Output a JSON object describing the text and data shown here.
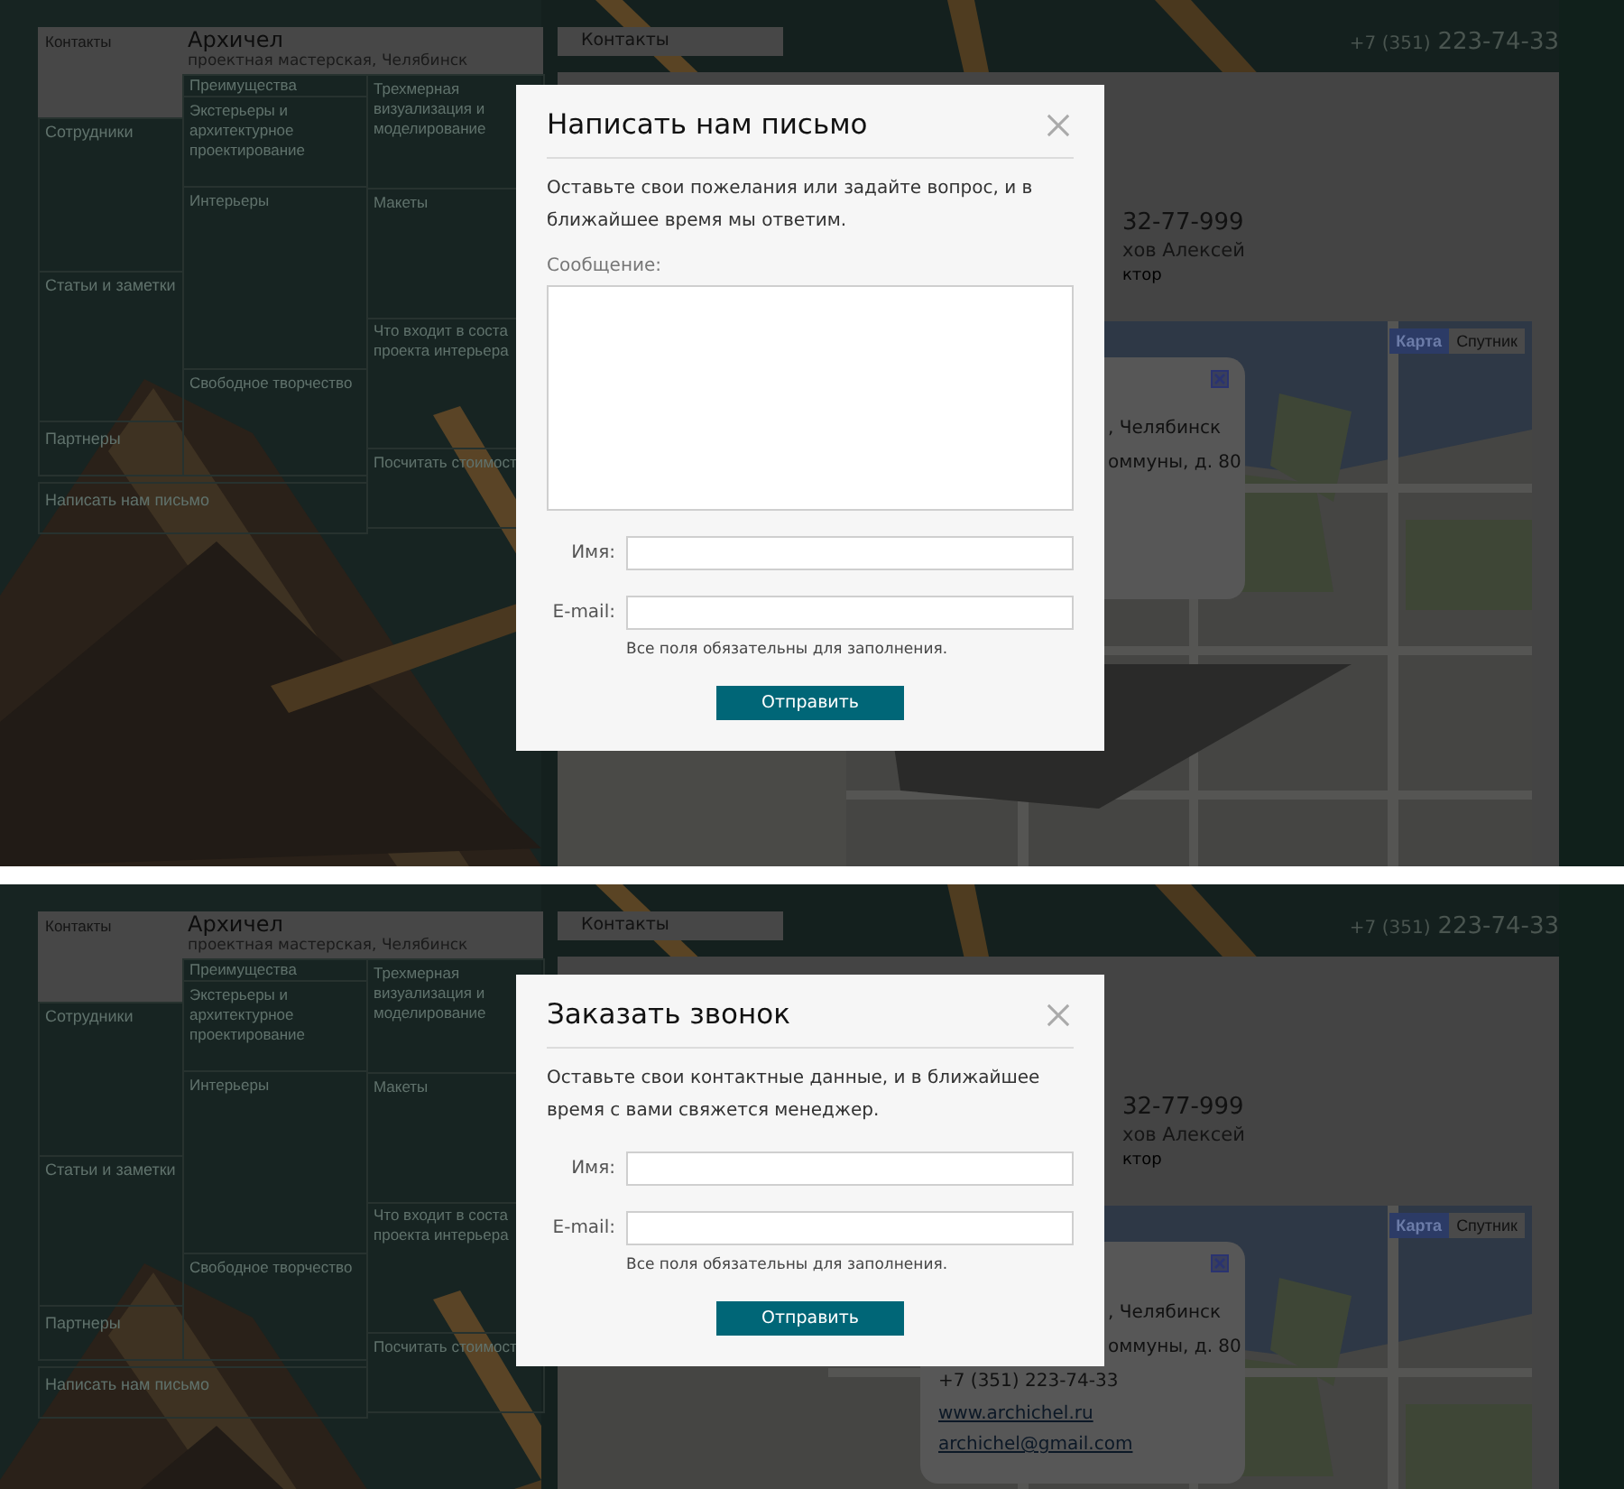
{
  "screens": [
    {
      "site": {
        "brand": {
          "name": "Архичел",
          "tagline": "проектная мастерская, Челябинск"
        },
        "menu_main": [
          {
            "label": "Контакты",
            "selected": true
          },
          {
            "label": "Сотрудники",
            "selected": false
          },
          {
            "label": "Статьи и заметки",
            "selected": false
          },
          {
            "label": "Партнеры",
            "selected": false
          }
        ],
        "menu_services": [
          {
            "label": "Преимущества",
            "selected": false
          },
          {
            "label": "Экстерьеры и архитектурное проектирование",
            "selected": false
          },
          {
            "label": "Интерьеры",
            "selected": false
          },
          {
            "label": "Свободное творчество",
            "selected": false
          }
        ],
        "menu_extra": [
          {
            "label": "Трехмерная визуализация и моделирование",
            "selected": false
          },
          {
            "label": "Макеты",
            "selected": false
          },
          {
            "label": "Что входит в соста\nпроекта интерьера",
            "selected": false
          },
          {
            "label": "Посчитать стоимост",
            "selected": false
          }
        ],
        "write_link": "Написать нам письмо",
        "tab": "Контакты",
        "phone": {
          "prefix": "+7 (351)",
          "number": "223-74-33"
        },
        "contact": {
          "phone": "32-77-999",
          "name": "хов Алексей",
          "role": "ктор"
        },
        "map": {
          "modes": [
            {
              "label": "Карта",
              "selected": true
            },
            {
              "label": "Спутник",
              "selected": false
            }
          ],
          "bubble": [
            {
              "kind": "tail",
              "text": ", Челябинск"
            },
            {
              "kind": "tail",
              "text": "оммуны, д. 80"
            }
          ]
        }
      },
      "dialog": {
        "title": "Написать нам письмо",
        "description": "Оставьте свои пожелания или задайте вопрос, и в ближайшее время мы ответим.",
        "fields": [
          {
            "kind": "textarea",
            "label": "Сообщение:"
          },
          {
            "kind": "input",
            "label": "Имя:"
          },
          {
            "kind": "input",
            "label": "E-mail:"
          }
        ],
        "note": "Все поля обязательны для заполнения.",
        "submit": "Отправить"
      }
    },
    {
      "site": {
        "brand": {
          "name": "Архичел",
          "tagline": "проектная мастерская, Челябинск"
        },
        "menu_main": [
          {
            "label": "Контакты",
            "selected": true
          },
          {
            "label": "Сотрудники",
            "selected": false
          },
          {
            "label": "Статьи и заметки",
            "selected": false
          },
          {
            "label": "Партнеры",
            "selected": false
          }
        ],
        "menu_services": [
          {
            "label": "Преимущества",
            "selected": false
          },
          {
            "label": "Экстерьеры и архитектурное проектирование",
            "selected": false
          },
          {
            "label": "Интерьеры",
            "selected": false
          },
          {
            "label": "Свободное творчество",
            "selected": false
          }
        ],
        "menu_extra": [
          {
            "label": "Трехмерная визуализация и моделирование",
            "selected": false
          },
          {
            "label": "Макеты",
            "selected": false
          },
          {
            "label": "Что входит в соста\nпроекта интерьера",
            "selected": false
          },
          {
            "label": "Посчитать стоимост",
            "selected": false
          }
        ],
        "write_link": "Написать нам письмо",
        "tab": "Контакты",
        "phone": {
          "prefix": "+7 (351)",
          "number": "223-74-33"
        },
        "contact": {
          "phone": "32-77-999",
          "name": "хов Алексей",
          "role": "ктор"
        },
        "map": {
          "modes": [
            {
              "label": "Карта",
              "selected": true
            },
            {
              "label": "Спутник",
              "selected": false
            }
          ],
          "bubble": [
            {
              "kind": "tail",
              "text": ", Челябинск"
            },
            {
              "kind": "tail",
              "text": "оммуны, д. 80"
            },
            {
              "kind": "text",
              "text": "+7 (351) 223-74-33"
            },
            {
              "kind": "link",
              "text": "www.archichel.ru"
            },
            {
              "kind": "link",
              "text": "archichel@gmail.com"
            }
          ]
        }
      },
      "dialog": {
        "title": "Заказать звонок",
        "description": "Оставьте свои контактные данные, и в ближайшее время с вами свяжется менеджер.",
        "fields": [
          {
            "kind": "input",
            "label": "Имя:"
          },
          {
            "kind": "input",
            "label": "E-mail:"
          }
        ],
        "note": "Все поля обязательны для заполнения.",
        "submit": "Отправить"
      }
    }
  ]
}
